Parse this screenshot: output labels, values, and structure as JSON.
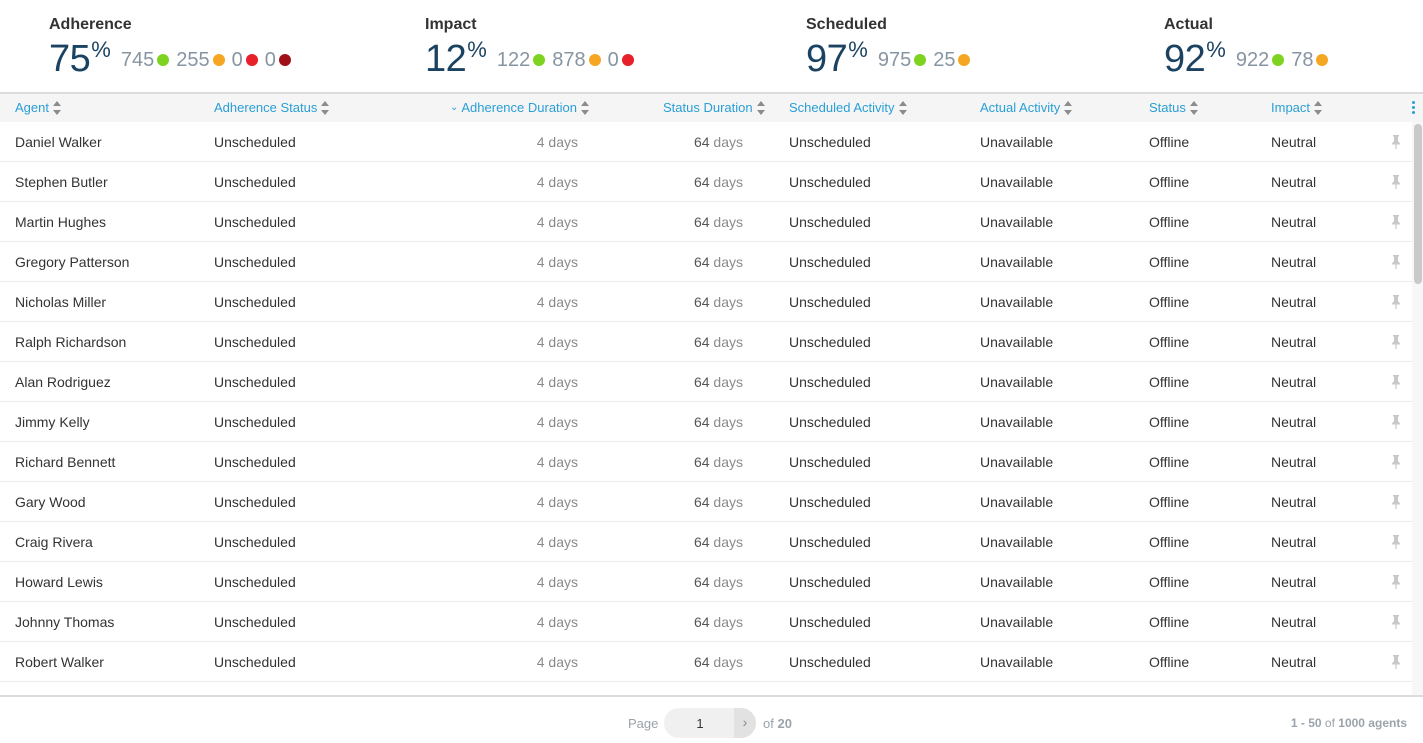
{
  "kpis": [
    {
      "title": "Adherence",
      "value": "75",
      "unit": "%",
      "counts": [
        {
          "value": "745",
          "color": "#7ed321"
        },
        {
          "value": "255",
          "color": "#f5a623"
        },
        {
          "value": "0",
          "color": "#e8202a"
        },
        {
          "value": "0",
          "color": "#a01018"
        }
      ]
    },
    {
      "title": "Impact",
      "value": "12",
      "unit": "%",
      "counts": [
        {
          "value": "122",
          "color": "#7ed321"
        },
        {
          "value": "878",
          "color": "#f5a623"
        },
        {
          "value": "0",
          "color": "#e8202a"
        }
      ]
    },
    {
      "title": "Scheduled",
      "value": "97",
      "unit": "%",
      "counts": [
        {
          "value": "975",
          "color": "#7ed321"
        },
        {
          "value": "25",
          "color": "#f5a623"
        }
      ]
    },
    {
      "title": "Actual",
      "value": "92",
      "unit": "%",
      "counts": [
        {
          "value": "922",
          "color": "#7ed321"
        },
        {
          "value": "78",
          "color": "#f5a623"
        }
      ]
    }
  ],
  "table": {
    "columns": {
      "agent": "Agent",
      "adherence_status": "Adherence Status",
      "adherence_duration": "Adherence Duration",
      "status_duration": "Status Duration",
      "scheduled_activity": "Scheduled Activity",
      "actual_activity": "Actual Activity",
      "status": "Status",
      "impact": "Impact"
    },
    "sorted_column": "adherence_duration",
    "rows": [
      {
        "agent": "Daniel Walker",
        "adherence_status": "Unscheduled",
        "adherence_duration": "4",
        "adherence_unit": "days",
        "status_duration": "64",
        "status_unit": "days",
        "scheduled_activity": "Unscheduled",
        "actual_activity": "Unavailable",
        "status": "Offline",
        "impact": "Neutral"
      },
      {
        "agent": "Stephen Butler",
        "adherence_status": "Unscheduled",
        "adherence_duration": "4",
        "adherence_unit": "days",
        "status_duration": "64",
        "status_unit": "days",
        "scheduled_activity": "Unscheduled",
        "actual_activity": "Unavailable",
        "status": "Offline",
        "impact": "Neutral"
      },
      {
        "agent": "Martin Hughes",
        "adherence_status": "Unscheduled",
        "adherence_duration": "4",
        "adherence_unit": "days",
        "status_duration": "64",
        "status_unit": "days",
        "scheduled_activity": "Unscheduled",
        "actual_activity": "Unavailable",
        "status": "Offline",
        "impact": "Neutral"
      },
      {
        "agent": "Gregory Patterson",
        "adherence_status": "Unscheduled",
        "adherence_duration": "4",
        "adherence_unit": "days",
        "status_duration": "64",
        "status_unit": "days",
        "scheduled_activity": "Unscheduled",
        "actual_activity": "Unavailable",
        "status": "Offline",
        "impact": "Neutral"
      },
      {
        "agent": "Nicholas Miller",
        "adherence_status": "Unscheduled",
        "adherence_duration": "4",
        "adherence_unit": "days",
        "status_duration": "64",
        "status_unit": "days",
        "scheduled_activity": "Unscheduled",
        "actual_activity": "Unavailable",
        "status": "Offline",
        "impact": "Neutral"
      },
      {
        "agent": "Ralph Richardson",
        "adherence_status": "Unscheduled",
        "adherence_duration": "4",
        "adherence_unit": "days",
        "status_duration": "64",
        "status_unit": "days",
        "scheduled_activity": "Unscheduled",
        "actual_activity": "Unavailable",
        "status": "Offline",
        "impact": "Neutral"
      },
      {
        "agent": "Alan Rodriguez",
        "adherence_status": "Unscheduled",
        "adherence_duration": "4",
        "adherence_unit": "days",
        "status_duration": "64",
        "status_unit": "days",
        "scheduled_activity": "Unscheduled",
        "actual_activity": "Unavailable",
        "status": "Offline",
        "impact": "Neutral"
      },
      {
        "agent": "Jimmy Kelly",
        "adherence_status": "Unscheduled",
        "adherence_duration": "4",
        "adherence_unit": "days",
        "status_duration": "64",
        "status_unit": "days",
        "scheduled_activity": "Unscheduled",
        "actual_activity": "Unavailable",
        "status": "Offline",
        "impact": "Neutral"
      },
      {
        "agent": "Richard Bennett",
        "adherence_status": "Unscheduled",
        "adherence_duration": "4",
        "adherence_unit": "days",
        "status_duration": "64",
        "status_unit": "days",
        "scheduled_activity": "Unscheduled",
        "actual_activity": "Unavailable",
        "status": "Offline",
        "impact": "Neutral"
      },
      {
        "agent": "Gary Wood",
        "adherence_status": "Unscheduled",
        "adherence_duration": "4",
        "adherence_unit": "days",
        "status_duration": "64",
        "status_unit": "days",
        "scheduled_activity": "Unscheduled",
        "actual_activity": "Unavailable",
        "status": "Offline",
        "impact": "Neutral"
      },
      {
        "agent": "Craig Rivera",
        "adherence_status": "Unscheduled",
        "adherence_duration": "4",
        "adherence_unit": "days",
        "status_duration": "64",
        "status_unit": "days",
        "scheduled_activity": "Unscheduled",
        "actual_activity": "Unavailable",
        "status": "Offline",
        "impact": "Neutral"
      },
      {
        "agent": "Howard Lewis",
        "adherence_status": "Unscheduled",
        "adherence_duration": "4",
        "adherence_unit": "days",
        "status_duration": "64",
        "status_unit": "days",
        "scheduled_activity": "Unscheduled",
        "actual_activity": "Unavailable",
        "status": "Offline",
        "impact": "Neutral"
      },
      {
        "agent": "Johnny Thomas",
        "adherence_status": "Unscheduled",
        "adherence_duration": "4",
        "adherence_unit": "days",
        "status_duration": "64",
        "status_unit": "days",
        "scheduled_activity": "Unscheduled",
        "actual_activity": "Unavailable",
        "status": "Offline",
        "impact": "Neutral"
      },
      {
        "agent": "Robert Walker",
        "adherence_status": "Unscheduled",
        "adherence_duration": "4",
        "adherence_unit": "days",
        "status_duration": "64",
        "status_unit": "days",
        "scheduled_activity": "Unscheduled",
        "actual_activity": "Unavailable",
        "status": "Offline",
        "impact": "Neutral"
      }
    ]
  },
  "icons": {
    "pin": "pin-icon",
    "sort": "sort-icon",
    "menu": "kebab-menu-icon",
    "next": "chevron-right-icon"
  },
  "pagination": {
    "page_label": "Page",
    "current_page": "1",
    "of_label": "of",
    "total_pages": "20",
    "next_glyph": "›",
    "range_text": "1 - 50",
    "range_of": "of",
    "total_text": "1000 agents"
  }
}
